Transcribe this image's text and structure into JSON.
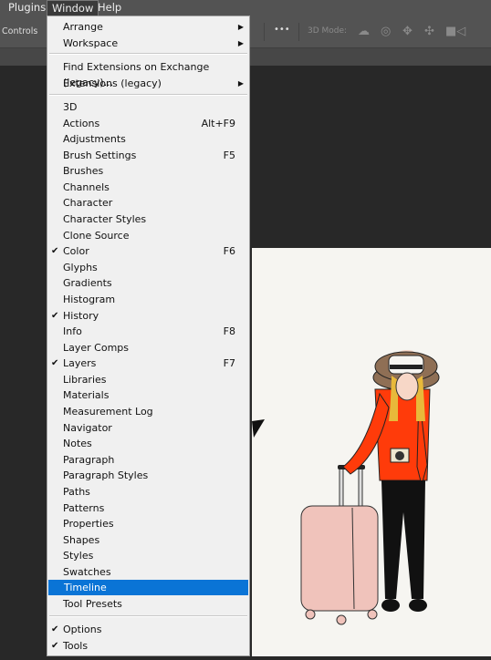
{
  "menubar": {
    "items": [
      "Plugins",
      "Window",
      "Help"
    ]
  },
  "options": {
    "label": "Controls",
    "more": "•••",
    "mode3d": "3D Mode:",
    "icons": [
      "orbit-icon",
      "roll-icon",
      "pan-icon",
      "slide-icon",
      "camera-icon"
    ]
  },
  "menu": {
    "top": [
      {
        "label": "Arrange",
        "submenu": true
      },
      {
        "label": "Workspace",
        "submenu": true
      }
    ],
    "ext": [
      {
        "label": "Find Extensions on Exchange (legacy)..."
      },
      {
        "label": "Extensions (legacy)",
        "submenu": true
      }
    ],
    "panels": [
      {
        "label": "3D"
      },
      {
        "label": "Actions",
        "shortcut": "Alt+F9"
      },
      {
        "label": "Adjustments"
      },
      {
        "label": "Brush Settings",
        "shortcut": "F5"
      },
      {
        "label": "Brushes"
      },
      {
        "label": "Channels"
      },
      {
        "label": "Character"
      },
      {
        "label": "Character Styles"
      },
      {
        "label": "Clone Source"
      },
      {
        "label": "Color",
        "shortcut": "F6",
        "checked": true
      },
      {
        "label": "Glyphs"
      },
      {
        "label": "Gradients"
      },
      {
        "label": "Histogram"
      },
      {
        "label": "History",
        "checked": true
      },
      {
        "label": "Info",
        "shortcut": "F8"
      },
      {
        "label": "Layer Comps"
      },
      {
        "label": "Layers",
        "shortcut": "F7",
        "checked": true
      },
      {
        "label": "Libraries"
      },
      {
        "label": "Materials"
      },
      {
        "label": "Measurement Log"
      },
      {
        "label": "Navigator"
      },
      {
        "label": "Notes"
      },
      {
        "label": "Paragraph"
      },
      {
        "label": "Paragraph Styles"
      },
      {
        "label": "Paths"
      },
      {
        "label": "Patterns"
      },
      {
        "label": "Properties"
      },
      {
        "label": "Shapes"
      },
      {
        "label": "Styles"
      },
      {
        "label": "Swatches"
      },
      {
        "label": "Timeline",
        "highlighted": true
      },
      {
        "label": "Tool Presets"
      }
    ],
    "bottom": [
      {
        "label": "Options",
        "checked": true
      },
      {
        "label": "Tools",
        "checked": true
      }
    ]
  },
  "colors": {
    "highlight": "#0a74d6",
    "menu_bg": "#f0f0f0",
    "chrome": "#535353"
  }
}
